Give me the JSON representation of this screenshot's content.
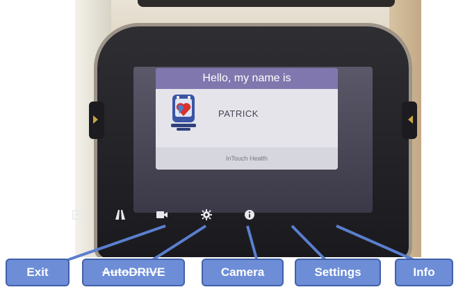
{
  "screen": {
    "greeting": "Hello, my name is",
    "name": "PATRICK",
    "footer": "InTouch Health"
  },
  "toolbar": {
    "exit_icon": "exit-icon",
    "drive_icon": "road-icon",
    "camera_icon": "video-camera-icon",
    "settings_icon": "gear-icon",
    "info_icon": "info-icon"
  },
  "callouts": {
    "exit": "Exit",
    "autodrive": "AutoDRIVE",
    "camera": "Camera",
    "settings": "Settings",
    "info": "Info"
  },
  "colors": {
    "callout_fill": "#6d8ed7",
    "callout_border": "#4060a8",
    "header_purple": "#7f77ad"
  }
}
